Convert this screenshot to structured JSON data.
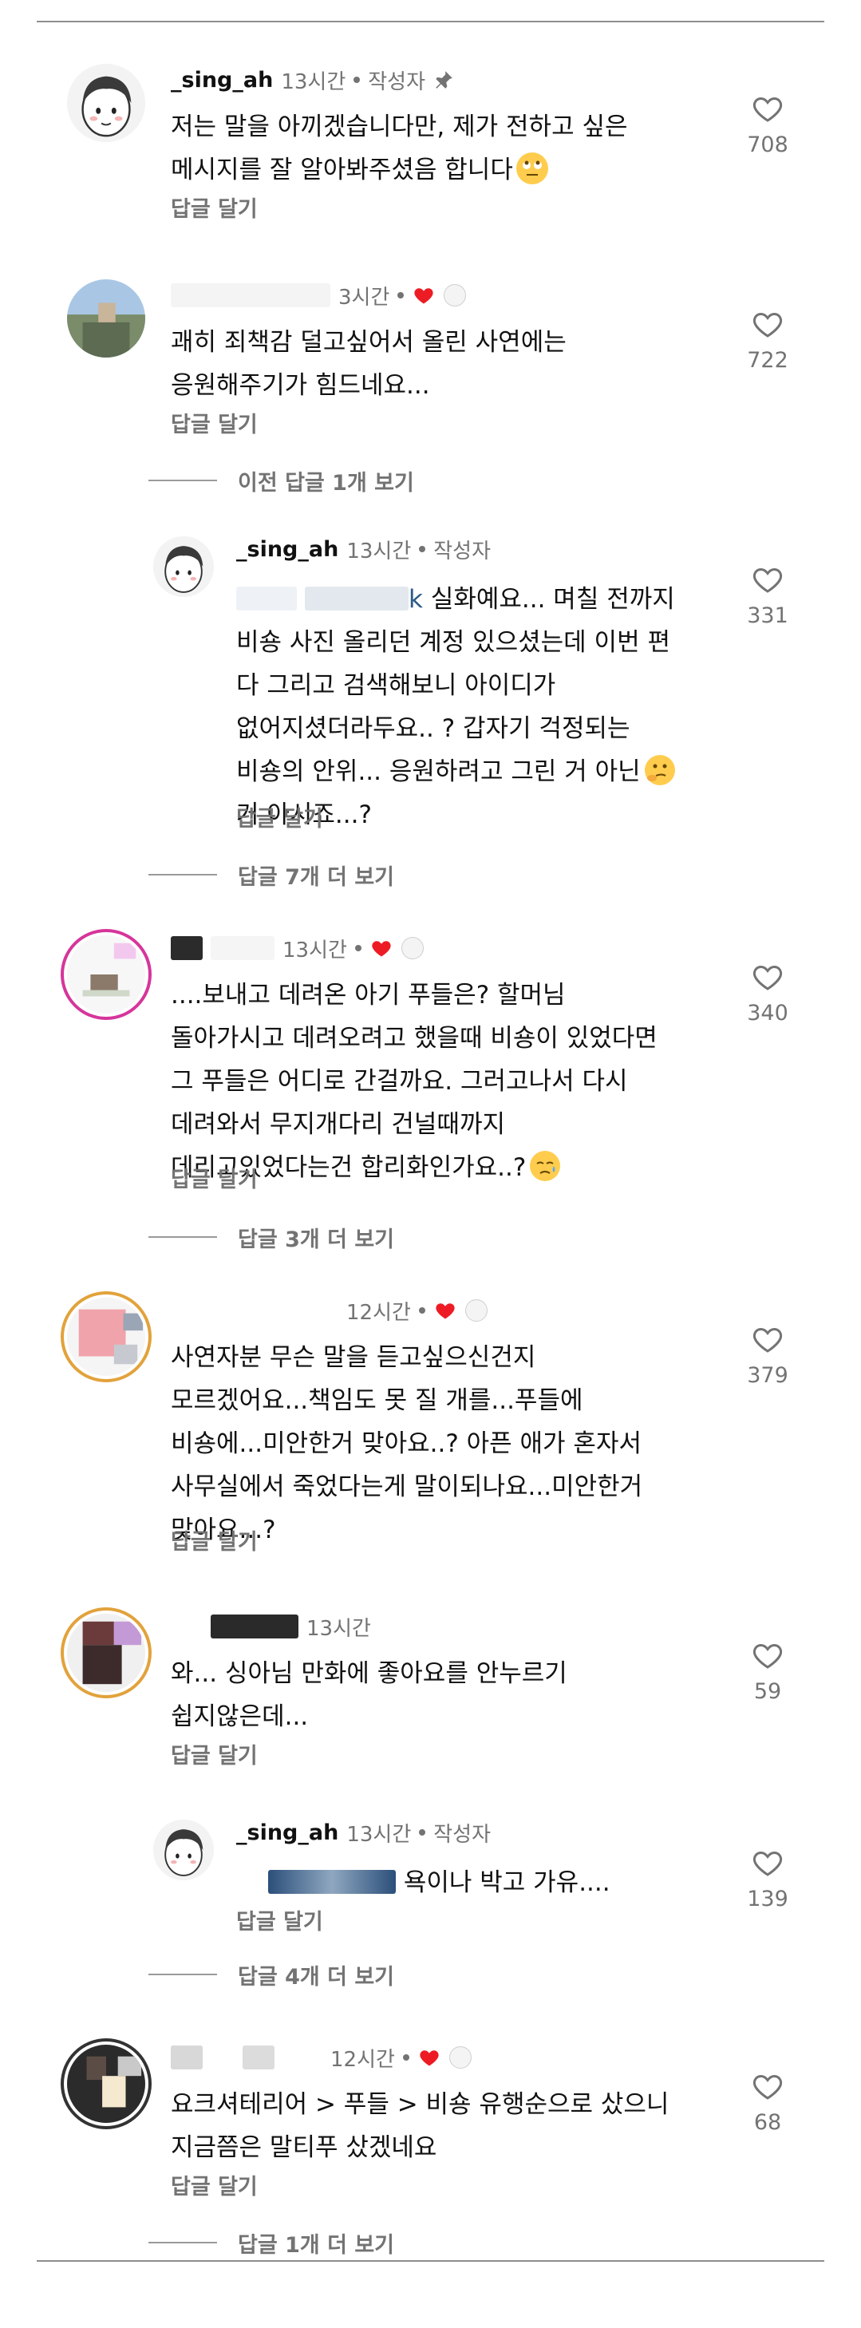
{
  "colors": {
    "accent_heart": "#ed1c24",
    "meta_gray": "#737373",
    "text": "#111111"
  },
  "comments": [
    {
      "username": "_sing_ah",
      "time": "13시간",
      "author_tag": "작성자",
      "lines": [
        "저는 말을 아끼겠습니다만, 제가 전하고 싶은",
        "메시지를 잘 알아봐주셨음 합니다"
      ],
      "reply_label": "답글 달기",
      "like_count": "708"
    },
    {
      "username": "",
      "time": "3시간",
      "lines": [
        "괘히 죄책감 덜고싶어서 올린 사연에는",
        "응원해주기가 힘드네요..."
      ],
      "reply_label": "답글 달기",
      "like_count": "722",
      "more_label": "이전 답글 1개 보기"
    },
    {
      "username": "_sing_ah",
      "time": "13시간",
      "author_tag": "작성자",
      "mention_suffix": "k",
      "lines": [
        "실화예요... 며칠 전까지",
        "비숑 사진 올리던 계정 있으셨는데 이번 편",
        "다 그리고 검색해보니 아이디가",
        "없어지셨더라두요.. ? 갑자기 걱정되는",
        "비숑의 안위... 응원하려고 그린 거 아닌",
        "거 아시죠...?"
      ],
      "reply_label": "답글 달기",
      "like_count": "331",
      "more_label": "답글 7개 더 보기"
    },
    {
      "username": "",
      "time": "13시간",
      "lines": [
        "....보내고 데려온 아기 푸들은? 할머님",
        "돌아가시고 데려오려고 했을때 비숑이 있었다면",
        "그 푸들은 어디로 간걸까요. 그러고나서 다시",
        "데려와서 무지개다리 건널때까지",
        "데리고있었다는건 합리화인가요..?"
      ],
      "reply_label": "답글 달기",
      "like_count": "340",
      "more_label": "답글 3개 더 보기"
    },
    {
      "username": "",
      "time": "12시간",
      "lines": [
        "사연자분 무슨 말을 듣고싶으신건지",
        "모르겠어요...책임도 못 질 개를...푸들에",
        "비숑에...미안한거 맞아요..? 아픈 애가 혼자서",
        "사무실에서 죽었다는게 말이되나요...미안한거",
        "맞아요...?"
      ],
      "reply_label": "답글 달기",
      "like_count": "379"
    },
    {
      "username": "",
      "time": "13시간",
      "lines": [
        "와... 싱아님 만화에 좋아요를 안누르기",
        "쉽지않은데..."
      ],
      "reply_label": "답글 달기",
      "like_count": "59"
    },
    {
      "username": "_sing_ah",
      "time": "13시간",
      "author_tag": "작성자",
      "lines": [
        "욕이나 박고 가유...."
      ],
      "reply_label": "답글 달기",
      "like_count": "139",
      "more_label": "답글 4개 더 보기"
    },
    {
      "username": "",
      "time": "12시간",
      "lines": [
        "요크셔테리어 > 푸들 > 비숑 유행순으로 샀으니",
        "지금쯤은 말티푸 샀겠네요"
      ],
      "reply_label": "답글 달기",
      "like_count": "68",
      "more_label": "답글 1개 더 보기"
    }
  ]
}
